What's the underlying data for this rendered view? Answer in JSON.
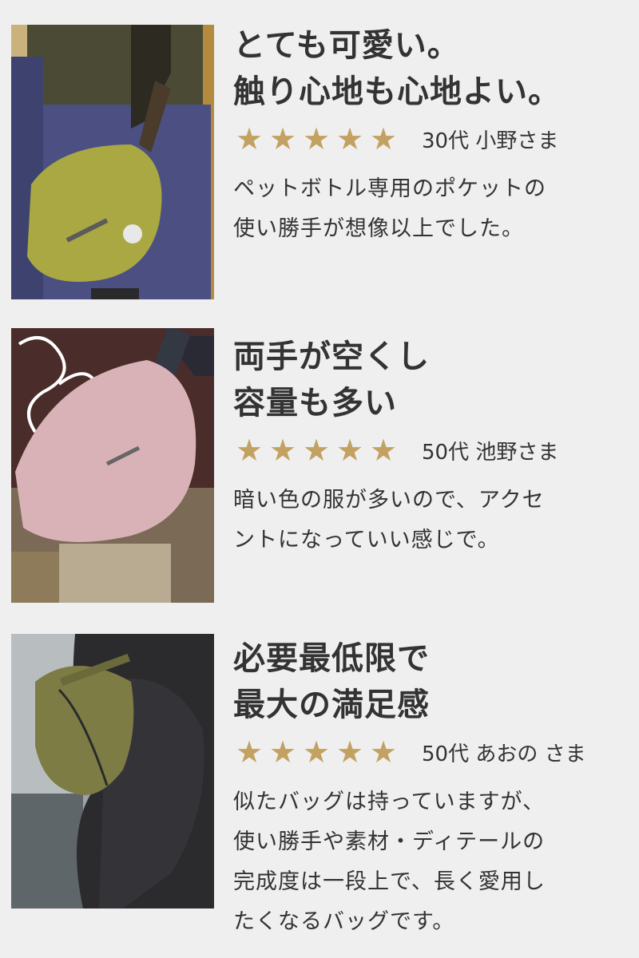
{
  "reviews": [
    {
      "headline": [
        "とても可愛い。",
        "触り心地も心地よい。"
      ],
      "stars": 5,
      "reviewer": "30代 小野さま",
      "body": [
        "ペットボトル専用のポケットの",
        "使い勝手が想像以上でした。"
      ],
      "bag_color": "#a9a843"
    },
    {
      "headline": [
        "両手が空くし",
        "容量も多い"
      ],
      "stars": 5,
      "reviewer": "50代 池野さま",
      "body": [
        "暗い色の服が多いので、アクセ",
        "ントになっていい感じで。"
      ],
      "bag_color": "#d9b2b8"
    },
    {
      "headline": [
        "必要最低限で",
        "最大の満足感"
      ],
      "stars": 5,
      "reviewer": "50代 あおの さま",
      "body": [
        "似たバッグは持っていますが、",
        "使い勝手や素材・ディテールの",
        "完成度は一段上で、長く愛用し",
        "たくなるバッグです。"
      ],
      "bag_color": "#7d7c45"
    }
  ],
  "star_glyph": "★",
  "star_color": "#c3a160"
}
